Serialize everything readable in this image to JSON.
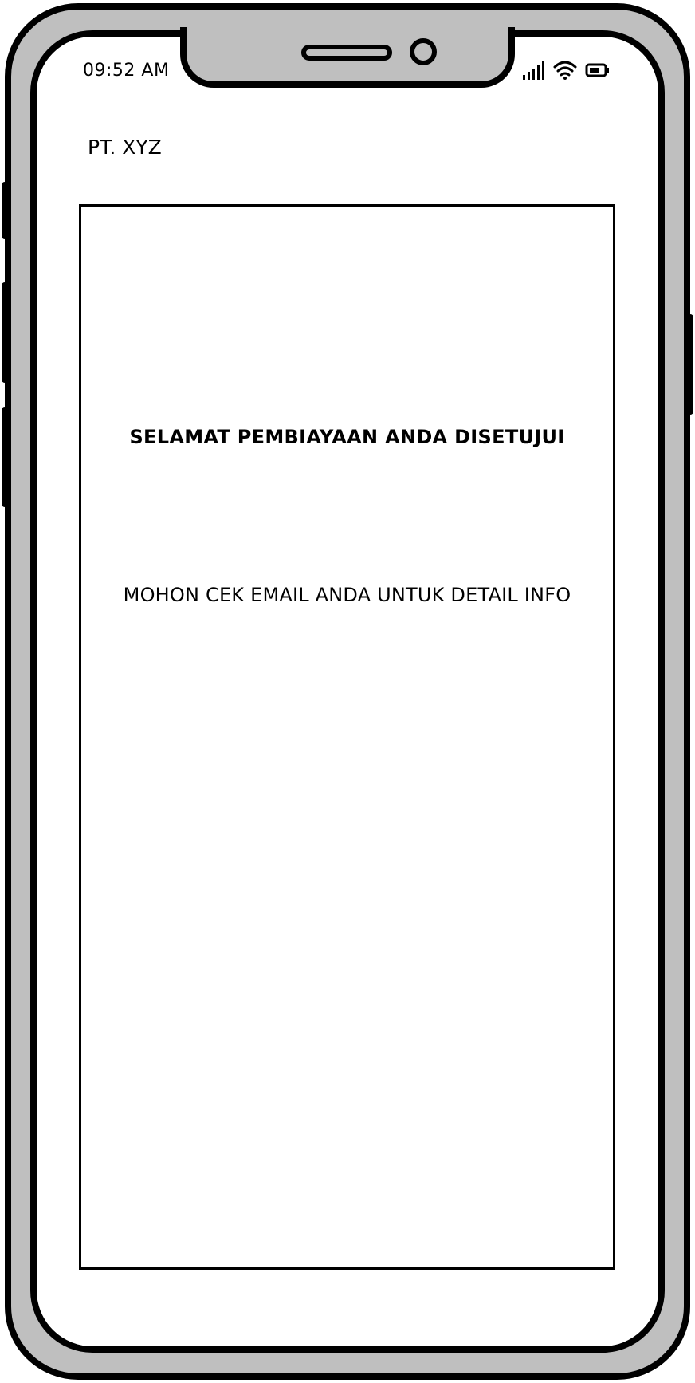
{
  "status_bar": {
    "time": "09:52 AM",
    "icons": [
      "signal-icon",
      "wifi-icon",
      "battery-icon"
    ]
  },
  "header": {
    "title": "PT. XYZ"
  },
  "message": {
    "headline": "SELAMAT PEMBIAYAAN ANDA DISETUJUI",
    "subtext": "MOHON CEK EMAIL ANDA UNTUK DETAIL INFO"
  },
  "colors": {
    "frame": "#bfbfbf",
    "outline": "#000000",
    "screen": "#ffffff"
  }
}
